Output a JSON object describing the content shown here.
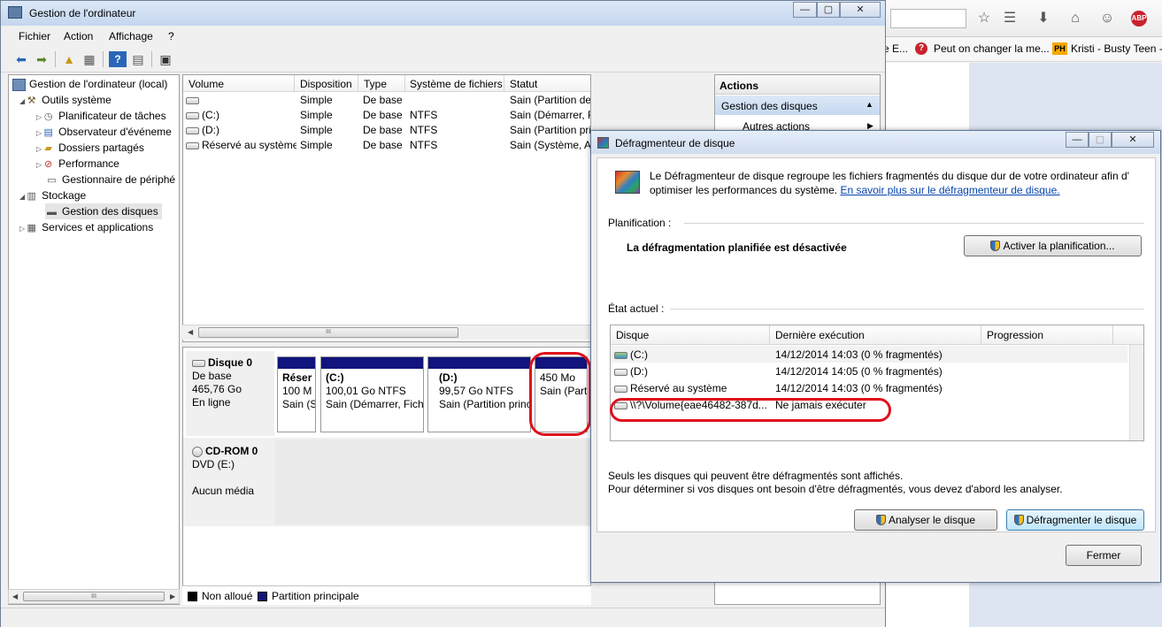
{
  "browser": {
    "bookmarks": [
      {
        "label": "e E..."
      },
      {
        "label": "Peut on changer la me..."
      },
      {
        "label": "Kristi - Busty Teen -"
      }
    ],
    "abp_label": "ABP",
    "ph_label": "PH",
    "q_label": "?"
  },
  "main_window": {
    "title": "Gestion de l'ordinateur",
    "caption": {
      "minimize": "—",
      "maximize": "▢",
      "close": "✕"
    },
    "menu": [
      "Fichier",
      "Action",
      "Affichage",
      "?"
    ],
    "tree": [
      {
        "label": "Gestion de l'ordinateur (local)",
        "icon": "computer-icon"
      },
      {
        "label": "Outils système",
        "icon": "tools-icon"
      },
      {
        "label": "Planificateur de tâches",
        "icon": "clock-icon"
      },
      {
        "label": "Observateur d'événeme",
        "icon": "event-viewer-icon"
      },
      {
        "label": "Dossiers partagés",
        "icon": "shared-folder-icon"
      },
      {
        "label": "Performance",
        "icon": "performance-icon"
      },
      {
        "label": "Gestionnaire de périphé",
        "icon": "device-manager-icon"
      },
      {
        "label": "Stockage",
        "icon": "storage-icon"
      },
      {
        "label": "Gestion des disques",
        "icon": "disk-management-icon"
      },
      {
        "label": "Services et applications",
        "icon": "services-icon"
      }
    ],
    "volume_columns": [
      "Volume",
      "Disposition",
      "Type",
      "Système de fichiers",
      "Statut"
    ],
    "volumes": [
      {
        "volume": "",
        "layout": "Simple",
        "type": "De base",
        "fs": "",
        "status": "Sain (Partition de récupération)"
      },
      {
        "volume": "(C:)",
        "layout": "Simple",
        "type": "De base",
        "fs": "NTFS",
        "status": "Sain (Démarrer, Fichier d'échange, Vidage s"
      },
      {
        "volume": "(D:)",
        "layout": "Simple",
        "type": "De base",
        "fs": "NTFS",
        "status": "Sain (Partition principale)"
      },
      {
        "volume": "Réservé au système",
        "layout": "Simple",
        "type": "De base",
        "fs": "NTFS",
        "status": "Sain (Système, Ac"
      }
    ],
    "scroll_grip": "III",
    "disk0": {
      "name": "Disque 0",
      "lines": [
        "De base",
        "465,76 Go",
        "En ligne"
      ],
      "partitions": [
        {
          "title": "Réser",
          "size": "100 M",
          "status": "Sain (S"
        },
        {
          "title": "(C:)",
          "size": "100,01 Go NTFS",
          "status": "Sain (Démarrer, Fich"
        },
        {
          "title": "(D:)",
          "size": "99,57 Go NTFS",
          "status": "Sain (Partition princ"
        },
        {
          "title": "",
          "size": "450 Mo",
          "status": "Sain (Part"
        }
      ]
    },
    "cdrom": {
      "name": "CD-ROM 0",
      "lines": [
        "DVD (E:)",
        "",
        "Aucun média"
      ]
    },
    "legend": [
      {
        "label": "Non alloué",
        "color": "#000000"
      },
      {
        "label": "Partition principale",
        "color": "#10147c"
      }
    ],
    "actions": {
      "title": "Actions",
      "section": "Gestion des disques",
      "more": "Autres actions"
    }
  },
  "defrag": {
    "title": "Défragmenteur de disque",
    "intro": "Le Défragmenteur de disque regroupe les fichiers fragmentés du disque dur de votre ordinateur afin d' optimiser les performances du système.",
    "intro_link": "En savoir plus sur le défragmenteur de disque.",
    "planning_label": "Planification :",
    "planning_status": "La défragmentation planifiée est désactivée",
    "planning_button": "Activer la planification...",
    "state_label": "État actuel :",
    "columns": [
      "Disque",
      "Dernière exécution",
      "Progression"
    ],
    "disks": [
      {
        "disk": "(C:)",
        "last": "14/12/2014 14:03 (0 % fragmentés)",
        "progress": ""
      },
      {
        "disk": "(D:)",
        "last": "14/12/2014 14:05 (0 % fragmentés)",
        "progress": ""
      },
      {
        "disk": "Réservé au système",
        "last": "14/12/2014 14:03 (0 % fragmentés)",
        "progress": ""
      },
      {
        "disk": "\\\\?\\Volume{eae46482-387d...",
        "last": "Ne jamais exécuter",
        "progress": ""
      }
    ],
    "footer_1": "Seuls les disques qui peuvent être défragmentés sont affichés.",
    "footer_2": "Pour déterminer si vos disques ont besoin d'être défragmentés, vous devez d'abord les analyser.",
    "analyze_button": "Analyser le disque",
    "defrag_button": "Défragmenter le disque",
    "close_button": "Fermer",
    "caption": {
      "minimize": "—",
      "maximize": "▢",
      "close": "✕"
    }
  }
}
